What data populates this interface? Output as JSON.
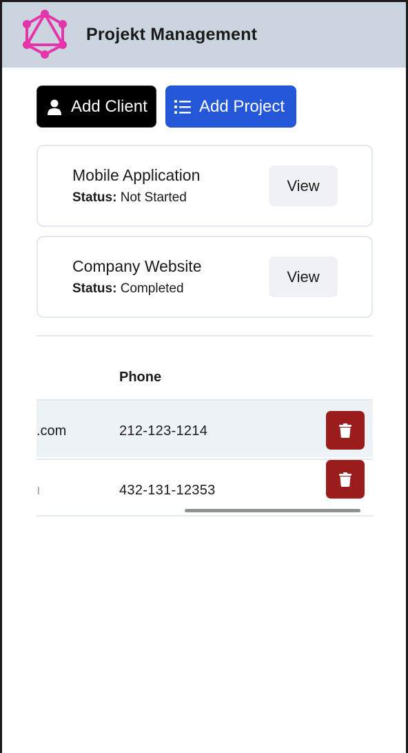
{
  "header": {
    "title": "Projekt Management",
    "logo_icon": "graphql-logo-icon",
    "logo_color": "#e535ab",
    "background": "#cbd5e0"
  },
  "actions": {
    "add_client_label": "Add Client",
    "add_client_icon": "user-icon",
    "add_project_label": "Add Project",
    "add_project_icon": "list-icon",
    "add_project_color": "#2458d8"
  },
  "projects": [
    {
      "name": "Mobile Application",
      "status_label": "Status:",
      "status": "Not Started",
      "view_label": "View"
    },
    {
      "name": "Company Website",
      "status_label": "Status:",
      "status": "Completed",
      "view_label": "View"
    }
  ],
  "clients_table": {
    "headers": {
      "phone": "Phone"
    },
    "rows": [
      {
        "email_fragment": ".com",
        "phone": "212-123-1214",
        "delete_icon": "trash-icon"
      },
      {
        "email_fragment": "ı",
        "phone": "432-131-12353",
        "delete_icon": "trash-icon"
      }
    ],
    "delete_color": "#9b1c1c"
  }
}
